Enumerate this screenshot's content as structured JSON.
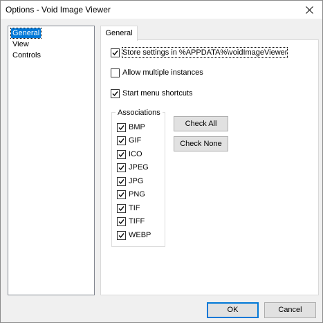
{
  "window": {
    "title": "Options - Void Image Viewer"
  },
  "nav": {
    "items": [
      {
        "label": "General",
        "selected": true
      },
      {
        "label": "View",
        "selected": false
      },
      {
        "label": "Controls",
        "selected": false
      }
    ]
  },
  "tab": {
    "label": "General"
  },
  "options": {
    "store_settings": {
      "label": "Store settings in %APPDATA%\\voidImageViewer",
      "checked": true
    },
    "allow_multiple": {
      "label": "Allow multiple instances",
      "checked": false
    },
    "start_menu": {
      "label": "Start menu shortcuts",
      "checked": true
    }
  },
  "associations": {
    "legend": "Associations",
    "items": [
      {
        "label": "BMP",
        "checked": true
      },
      {
        "label": "GIF",
        "checked": true
      },
      {
        "label": "ICO",
        "checked": true
      },
      {
        "label": "JPEG",
        "checked": true
      },
      {
        "label": "JPG",
        "checked": true
      },
      {
        "label": "PNG",
        "checked": true
      },
      {
        "label": "TIF",
        "checked": true
      },
      {
        "label": "TIFF",
        "checked": true
      },
      {
        "label": "WEBP",
        "checked": true
      }
    ],
    "check_all_label": "Check All",
    "check_none_label": "Check None"
  },
  "footer": {
    "ok_label": "OK",
    "cancel_label": "Cancel"
  },
  "colors": {
    "selection": "#0078d7",
    "accent_border": "#0078d7"
  }
}
